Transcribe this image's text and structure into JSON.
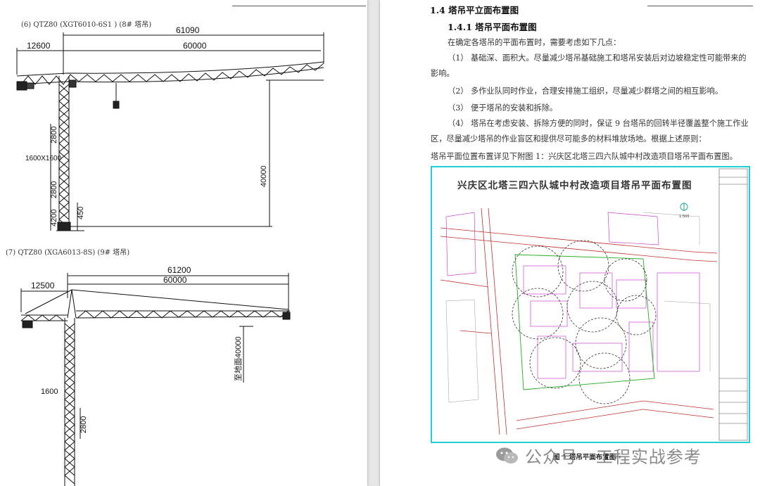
{
  "left_page": {
    "crane6": {
      "caption": "(6) QTZ80 (XGT6010-6S1 ) (8# 塔吊)",
      "dims": {
        "span_total": "61090",
        "rear_arm": "12600",
        "jib": "60000",
        "height": "40000",
        "section": "2800",
        "mast": "1600X1600",
        "section_b": "2800",
        "base_a": "4200",
        "base_b": "450"
      }
    },
    "crane7": {
      "caption": "(7) QTZ80 (XGA6013-8S) (9# 塔吊)",
      "dims": {
        "span_total": "61200",
        "rear_arm": "12500",
        "jib": "60000",
        "height": "至地面40000",
        "mast": "1600",
        "section": "2800"
      }
    }
  },
  "right_page": {
    "heading_1": "1.4 塔吊平立面布置图",
    "heading_2": "1.4.1 塔吊平面布置图",
    "intro": "在确定各塔吊的平面布置时，需要考虑如下几点：",
    "point_1": "（1） 基础深、面积大。尽量减少塔吊基础施工和塔吊安装后对边坡稳定性可能带来的影响。",
    "point_2": "（2） 多作业队同时作业，合理安排施工组织，尽量减少群塔之间的相互影响。",
    "point_3": "（3） 便于塔吊的安装和拆除。",
    "point_4": "（4） 塔吊在考虑安装、拆除方便的同时，保证 9 台塔吊的回转半径覆盖整个施工作业区，尽量减少塔吊的作业盲区和提供尽可能多的材料堆放场地。根据上述原则：",
    "ref_line": "塔吊平面位置布置详见下附图 1：兴庆区北塔三四六队城中村改造项目塔吊平面布置图。",
    "plan_title": "兴庆区北塔三四六队城中村改造项目塔吊平面布置图",
    "plan_scale": "1:500",
    "figure_caption": "图 1 塔吊平面布置图一"
  },
  "watermark": {
    "text": "公众号 · 工程实战参考",
    "icon": "wechat-icon"
  },
  "colors": {
    "frame": "#1fcfd8",
    "road": "#c03030",
    "building": "#cc44cc",
    "site": "#22aa22",
    "circle": "#333333"
  }
}
